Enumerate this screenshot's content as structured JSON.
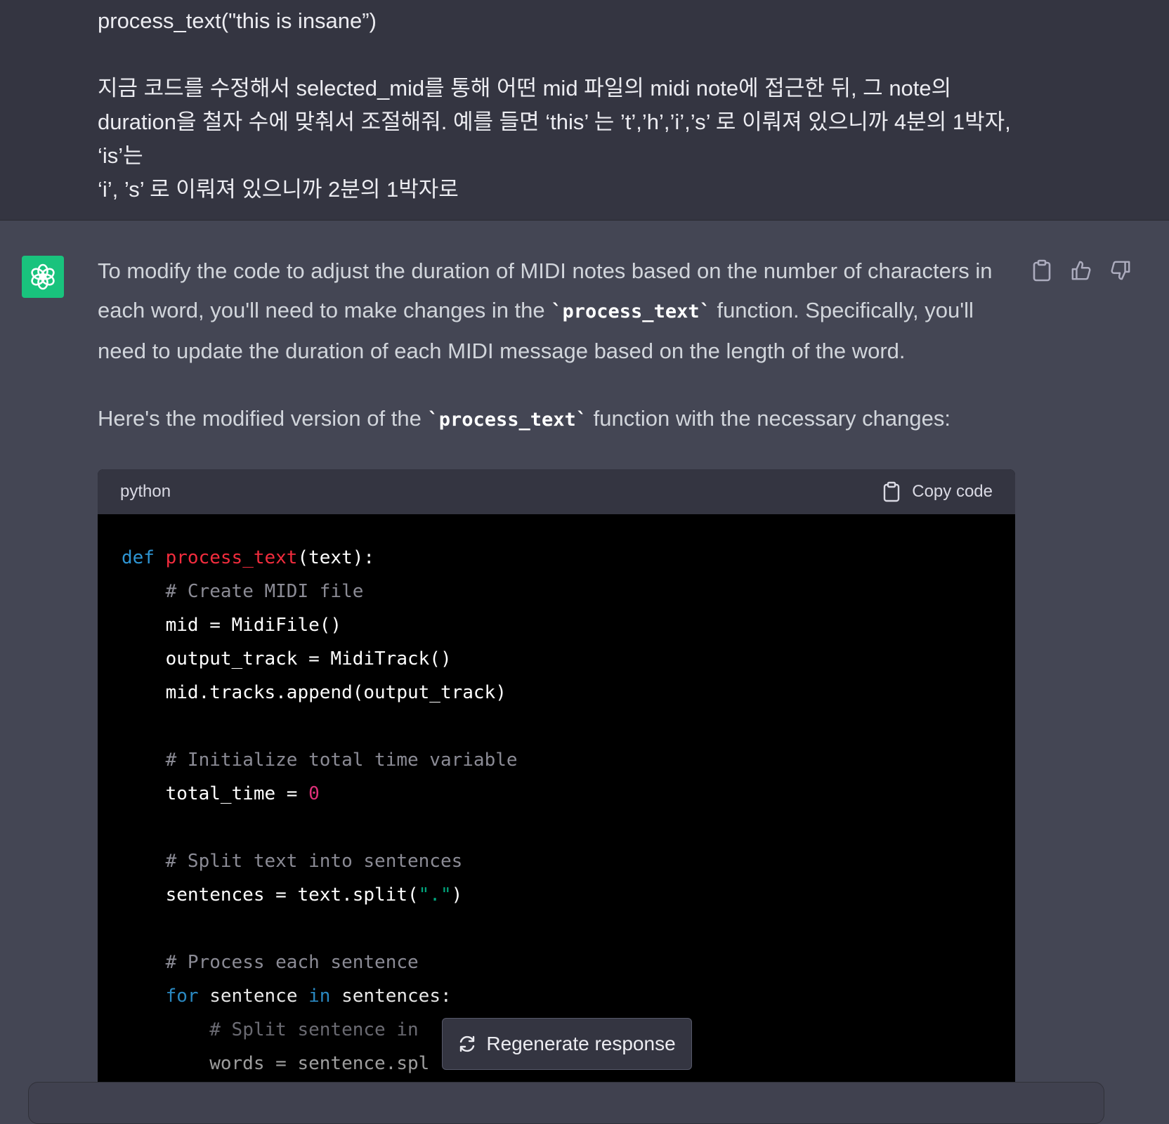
{
  "user_message": {
    "line1": "process_text(\"this is insane”)",
    "line2": "지금 코드를 수정해서 selected_mid를 통해 어떤 mid 파일의 midi note에 접근한 뒤, 그 note의",
    "line3": "duration을 철자 수에 맞춰서 조절해줘. 예를 들면 ‘this’ 는 ’t’,’h’,’i’,’s’ 로 이뤄져 있으니까 4분의 1박자, ‘is’는",
    "line4": "‘i’, ’s’ 로 이뤄져 있으니까 2분의 1박자로"
  },
  "assistant": {
    "avatar_icon": "openai-logo-icon",
    "avatar_color": "#19c37d",
    "para1_text1": "To modify the code to adjust the duration of MIDI notes based on the number of characters in each word, you'll need to make changes in the ",
    "para1_code": "`process_text`",
    "para1_text2": " function. Specifically, you'll need to update the duration of each MIDI message based on the length of the word.",
    "para2_text1": "Here's the modified version of the ",
    "para2_code": "`process_text`",
    "para2_text2": " function with the necessary changes:",
    "actions": [
      "clipboard-icon",
      "thumbs-up-icon",
      "thumbs-down-icon"
    ]
  },
  "code_block": {
    "language": "python",
    "copy_label": "Copy code",
    "lines": [
      "def process_text(text):",
      "    # Create MIDI file",
      "    mid = MidiFile()",
      "    output_track = MidiTrack()",
      "    mid.tracks.append(output_track)",
      "",
      "    # Initialize total time variable",
      "    total_time = 0",
      "",
      "    # Split text into sentences",
      "    sentences = text.split(\".\")",
      "",
      "    # Process each sentence",
      "    for sentence in sentences:",
      "        # Split sentence in",
      "        words = sentence.spl"
    ]
  },
  "regenerate": {
    "label": "Regenerate response",
    "icon": "refresh-icon"
  },
  "colors": {
    "user_bg": "#343541",
    "assistant_bg": "#444654",
    "code_bg": "#000000",
    "keyword": "#2e95d3",
    "function": "#f22c3d",
    "comment": "#8b8b95",
    "number": "#df3079",
    "string": "#00a67d"
  }
}
